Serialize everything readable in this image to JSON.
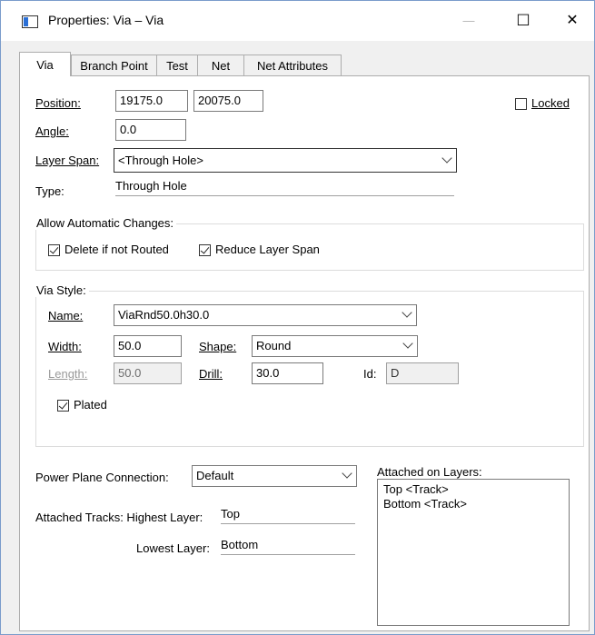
{
  "window": {
    "title": "Properties: Via – Via",
    "minimize_label": "—",
    "maximize_label": "☐",
    "close_label": "✕"
  },
  "tabs": [
    {
      "label": "Via"
    },
    {
      "label": "Branch Point"
    },
    {
      "label": "Test"
    },
    {
      "label": "Net"
    },
    {
      "label": "Net Attributes"
    }
  ],
  "position": {
    "label": "Position:",
    "x": "19175.0",
    "y": "20075.0"
  },
  "locked": {
    "label": "Locked",
    "checked": false
  },
  "angle": {
    "label": "Angle:",
    "value": "0.0"
  },
  "layer_span": {
    "label": "Layer Span:",
    "value": "<Through Hole>"
  },
  "type": {
    "label": "Type:",
    "value": "Through Hole"
  },
  "auto_changes": {
    "legend": "Allow Automatic Changes:",
    "delete_if_not_routed": {
      "label": "Delete if not Routed",
      "checked": true
    },
    "reduce_layer_span": {
      "label": "Reduce Layer Span",
      "checked": true
    }
  },
  "via_style": {
    "legend": "Via Style:",
    "name_label": "Name:",
    "name_value": "ViaRnd50.0h30.0",
    "width_label": "Width:",
    "width_value": "50.0",
    "shape_label": "Shape:",
    "shape_value": "Round",
    "length_label": "Length:",
    "length_value": "50.0",
    "drill_label": "Drill:",
    "drill_value": "30.0",
    "id_label": "Id:",
    "id_value": "D",
    "plated": {
      "label": "Plated",
      "checked": true
    }
  },
  "power_plane": {
    "label": "Power Plane Connection:",
    "value": "Default"
  },
  "attached_tracks": {
    "highest_label": "Attached Tracks: Highest Layer:",
    "highest_value": "Top",
    "lowest_label": "Lowest Layer:",
    "lowest_value": "Bottom"
  },
  "attached_layers": {
    "label": "Attached on Layers:",
    "items": [
      "Top <Track>",
      "Bottom <Track>"
    ]
  }
}
